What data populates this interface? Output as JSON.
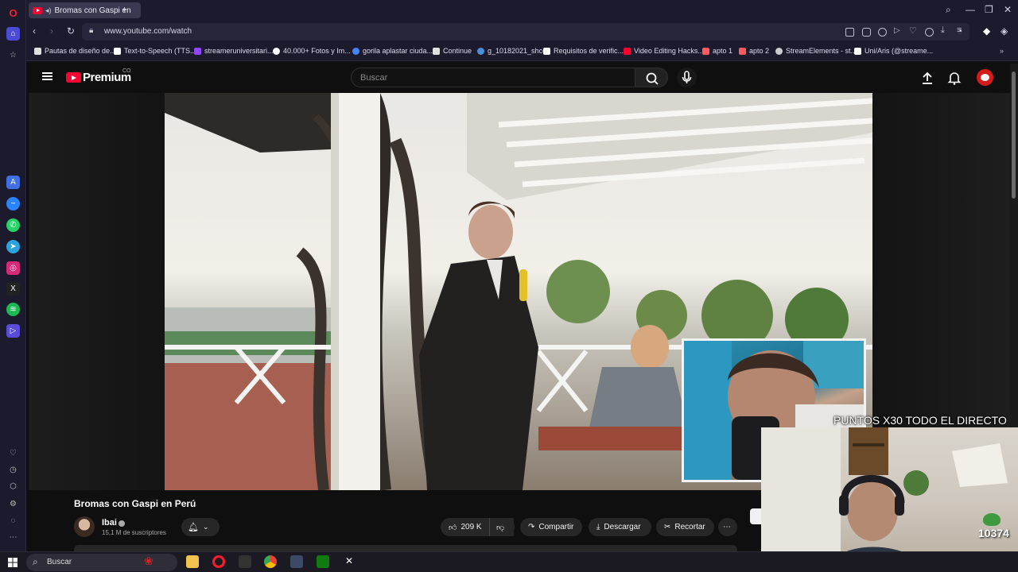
{
  "browser": {
    "tab_title": "Bromas con Gaspi en",
    "url": "www.youtube.com/watch",
    "new_tab": "+"
  },
  "window_controls": [
    "⌕",
    "—",
    "❐",
    "✕"
  ],
  "bookmarks": [
    {
      "label": "Pautas de diseño de...",
      "color": "#e0e0e0"
    },
    {
      "label": "Text-to-Speech (TTS...",
      "color": "#ffffff"
    },
    {
      "label": "streameruniversitari...",
      "color": "#9146ff"
    },
    {
      "label": "40.000+ Fotos y Im...",
      "color": "#ffffff"
    },
    {
      "label": "gorila aplastar ciuda...",
      "color": "#4285f4"
    },
    {
      "label": "Continue",
      "color": "#e0e0e0"
    },
    {
      "label": "g_10182021_shcc",
      "color": "#4a90d9"
    },
    {
      "label": "Requisitos de verific...",
      "color": "#ffffff"
    },
    {
      "label": "Video Editing Hacks...",
      "color": "#ff0033"
    },
    {
      "label": "apto 1",
      "color": "#ff5a5f"
    },
    {
      "label": "apto 2",
      "color": "#ff5a5f"
    },
    {
      "label": "StreamElements - st...",
      "color": "#cccccc"
    },
    {
      "label": "Uni/Aris (@streame...",
      "color": "#ffffff"
    }
  ],
  "youtube": {
    "logo": "Premium",
    "country": "CO",
    "search_placeholder": "Buscar"
  },
  "video": {
    "title": "Bromas con Gaspi en Perú",
    "channel": "Ibai",
    "subscribers": "15,1 M de suscriptores",
    "likes": "209 K",
    "share": "Compartir",
    "download": "Descargar",
    "clip": "Recortar",
    "more": "⋯"
  },
  "overlay": {
    "banner": "PUNTOS X30 TODO EL DIRECTO",
    "points": "10374"
  },
  "taskbar": {
    "search": "Buscar"
  }
}
